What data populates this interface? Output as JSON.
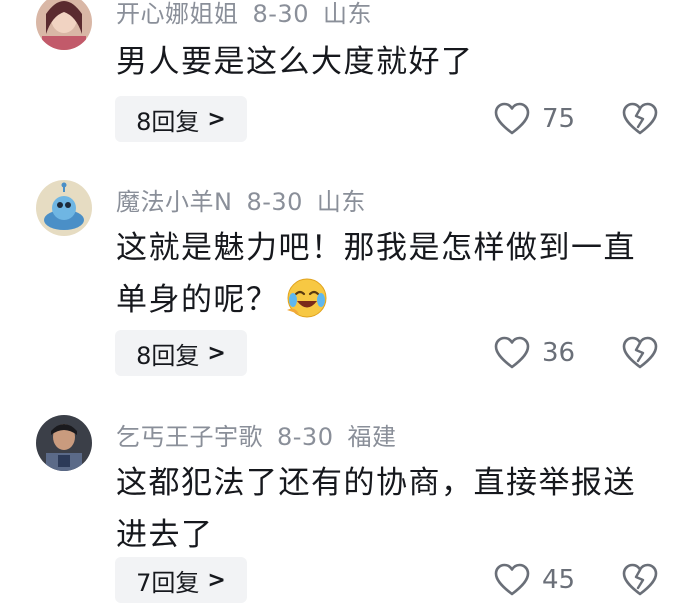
{
  "comments": [
    {
      "username": "开心娜姐姐",
      "date": "8-30",
      "location": "山东",
      "text": "男人要是这么大度就好了",
      "reply_label": "8回复",
      "likes": "75"
    },
    {
      "username": "魔法小羊N",
      "date": "8-30",
      "location": "山东",
      "text": "这就是魅力吧！那我是怎样做到一直单身的呢？",
      "emoji": "crying-laughing-emoji",
      "reply_label": "8回复",
      "likes": "36"
    },
    {
      "username": "乞丐王子宇歌",
      "date": "8-30",
      "location": "福建",
      "text": "这都犯法了还有的协商，直接举报送进去了",
      "reply_label": "7回复",
      "likes": "45"
    }
  ],
  "icons": {
    "like": "heart-outline-icon",
    "dislike": "broken-heart-icon",
    "reply_chevron": "chevron-right-icon"
  },
  "colors": {
    "meta": "#8a8f99",
    "text": "#16181d",
    "reply_bg": "#f2f3f5",
    "icon": "#6a6f78"
  }
}
